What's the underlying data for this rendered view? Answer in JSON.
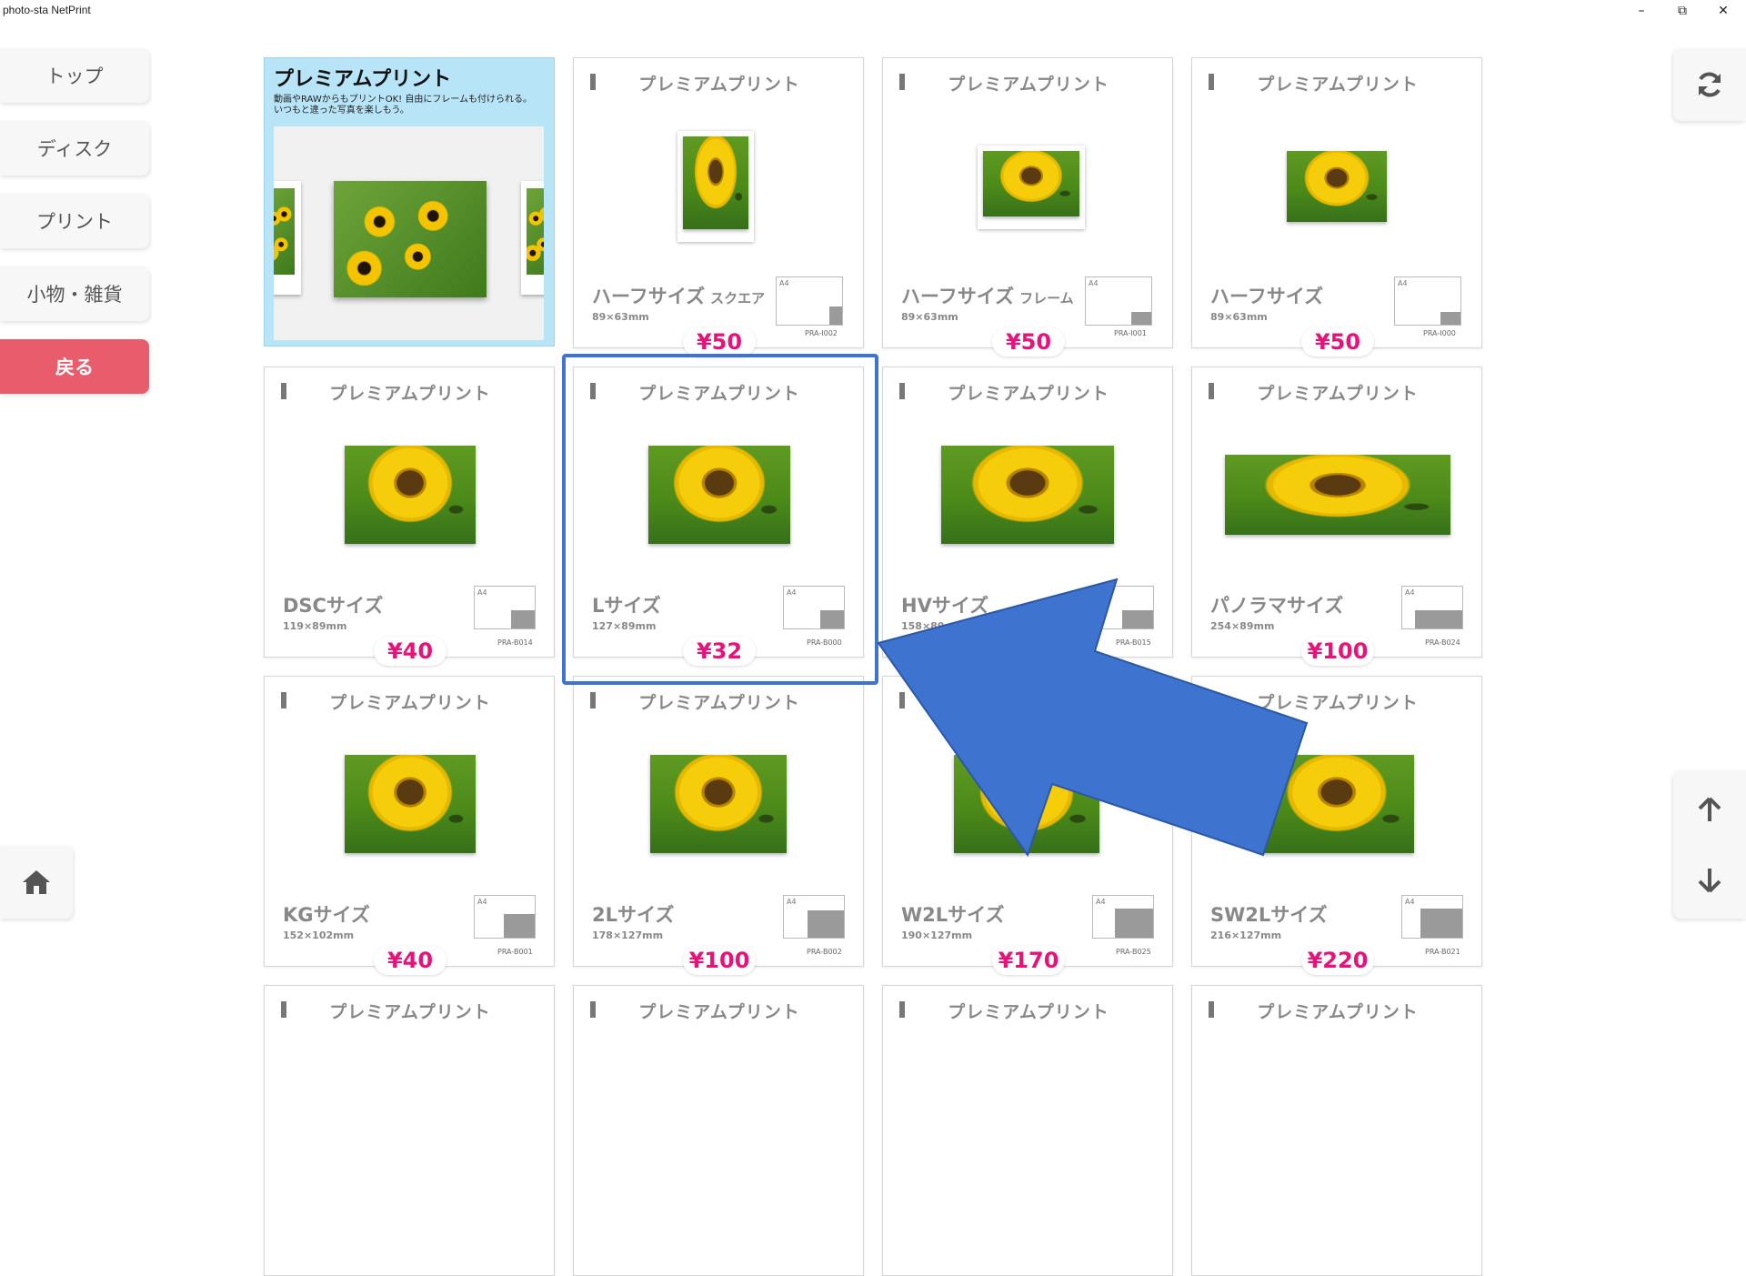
{
  "window": {
    "title": "photo-sta NetPrint",
    "controls": {
      "minimize": "–",
      "maximize": "⧉",
      "close": "✕"
    }
  },
  "nav": {
    "items": [
      {
        "label": "トップ"
      },
      {
        "label": "ディスク"
      },
      {
        "label": "プリント"
      },
      {
        "label": "小物・雑貨"
      },
      {
        "label": "戻る"
      }
    ],
    "home_icon": "home-icon"
  },
  "right_controls": {
    "refresh_icon": "refresh-icon",
    "up_icon": "arrow-up-icon",
    "down_icon": "arrow-down-icon"
  },
  "promo": {
    "title": "プレミアムプリント",
    "text": "動画やRAWからもプリントOK! 自由にフレームも付けられる。\nいつもと違った写真を楽しもう。"
  },
  "cards": [
    {
      "category": "プレミアムプリント",
      "name": "ハーフサイズ",
      "sub": "スクエア",
      "dims": "89×63mm",
      "code": "PRA-I002",
      "price": "¥50"
    },
    {
      "category": "プレミアムプリント",
      "name": "ハーフサイズ",
      "sub": "フレーム",
      "dims": "89×63mm",
      "code": "PRA-I001",
      "price": "¥50"
    },
    {
      "category": "プレミアムプリント",
      "name": "ハーフサイズ",
      "sub": "",
      "dims": "89×63mm",
      "code": "PRA-I000",
      "price": "¥50"
    },
    {
      "category": "プレミアムプリント",
      "name": "DSCサイズ",
      "sub": "",
      "dims": "119×89mm",
      "code": "PRA-B014",
      "price": "¥40"
    },
    {
      "category": "プレミアムプリント",
      "name": "Lサイズ",
      "sub": "",
      "dims": "127×89mm",
      "code": "PRA-B000",
      "price": "¥32"
    },
    {
      "category": "プレミアムプリント",
      "name": "HVサイズ",
      "sub": "",
      "dims": "158×89mm",
      "code": "PRA-B015",
      "price": ""
    },
    {
      "category": "プレミアムプリント",
      "name": "パノラマサイズ",
      "sub": "",
      "dims": "254×89mm",
      "code": "PRA-B024",
      "price": "¥100"
    },
    {
      "category": "プレミアムプリント",
      "name": "KGサイズ",
      "sub": "",
      "dims": "152×102mm",
      "code": "PRA-B001",
      "price": "¥40"
    },
    {
      "category": "プレミアムプリント",
      "name": "2Lサイズ",
      "sub": "",
      "dims": "178×127mm",
      "code": "PRA-B002",
      "price": "¥100"
    },
    {
      "category": "プレミアムプリント",
      "name": "W2Lサイズ",
      "sub": "",
      "dims": "190×127mm",
      "code": "PRA-B025",
      "price": "¥170"
    },
    {
      "category": "プレミアムプリント",
      "name": "SW2Lサイズ",
      "sub": "",
      "dims": "216×127mm",
      "code": "PRA-B021",
      "price": "¥220"
    },
    {
      "category": "プレミアムプリント"
    },
    {
      "category": "プレミアムプリント"
    },
    {
      "category": "プレミアムプリント"
    },
    {
      "category": "プレミアムプリント"
    }
  ],
  "paper_label": "A4",
  "colors": {
    "accent_price": "#e8137a",
    "back_button": "#e85c6c",
    "highlight": "#3e74cf",
    "promo_bg": "#b7e4f6"
  }
}
